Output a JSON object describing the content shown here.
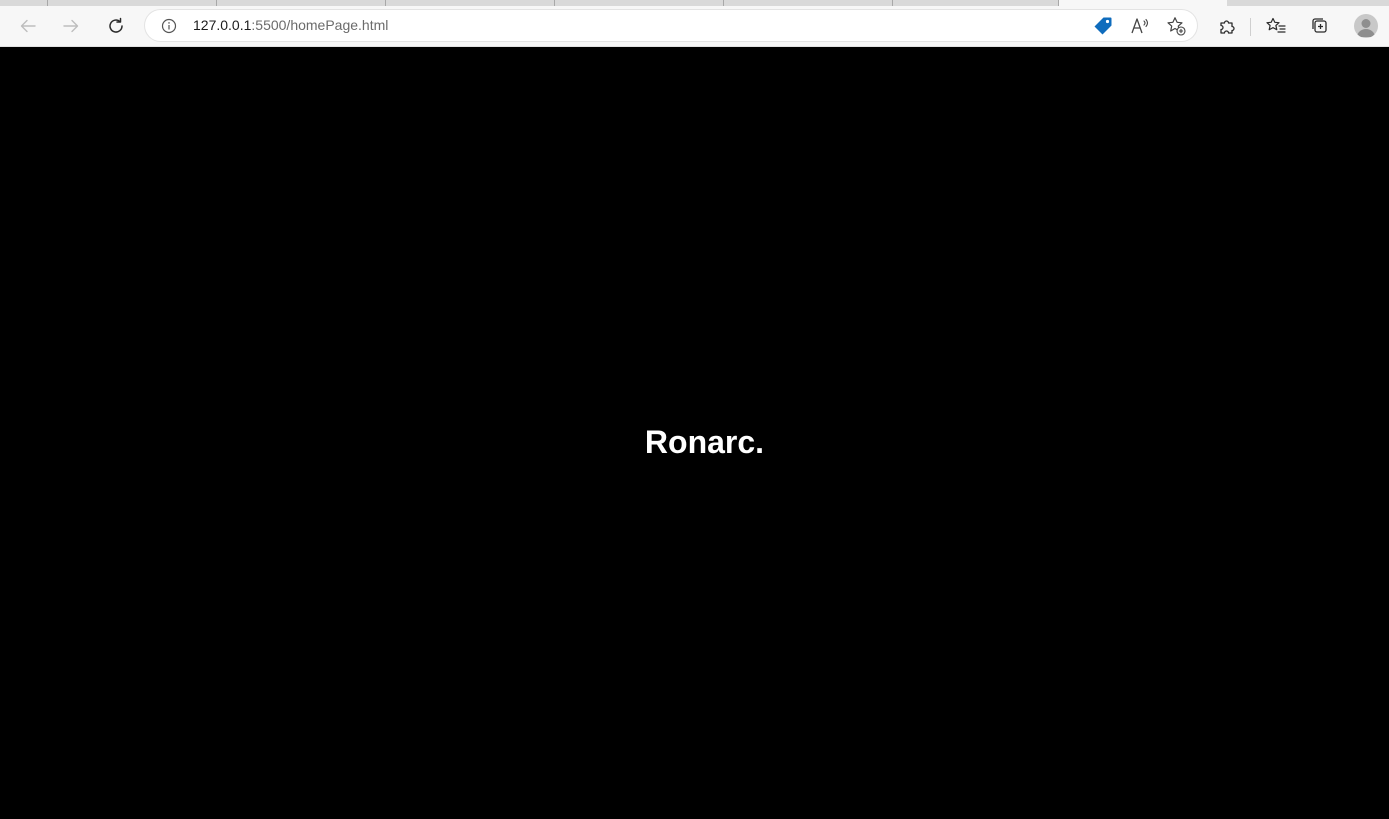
{
  "browser": {
    "address_bar": {
      "url_host": "127.0.0.1",
      "url_rest": ":5500/homePage.html"
    },
    "icons": {
      "back": "arrow-left-icon",
      "forward": "arrow-right-icon",
      "refresh": "refresh-icon",
      "site_info": "info-icon",
      "coupon": "tag-icon",
      "read_aloud": "read-aloud-icon",
      "add_favorite": "star-plus-icon",
      "extensions": "puzzle-icon",
      "favorites": "favorites-list-icon",
      "collections": "collections-icon",
      "profile": "profile-avatar-icon"
    },
    "colors": {
      "toolbar_bg": "#f7f7f7",
      "accent_blue": "#0f6cbd"
    }
  },
  "page": {
    "brand_text": "Ronarc.",
    "background_color": "#000000",
    "text_color": "#ffffff"
  }
}
